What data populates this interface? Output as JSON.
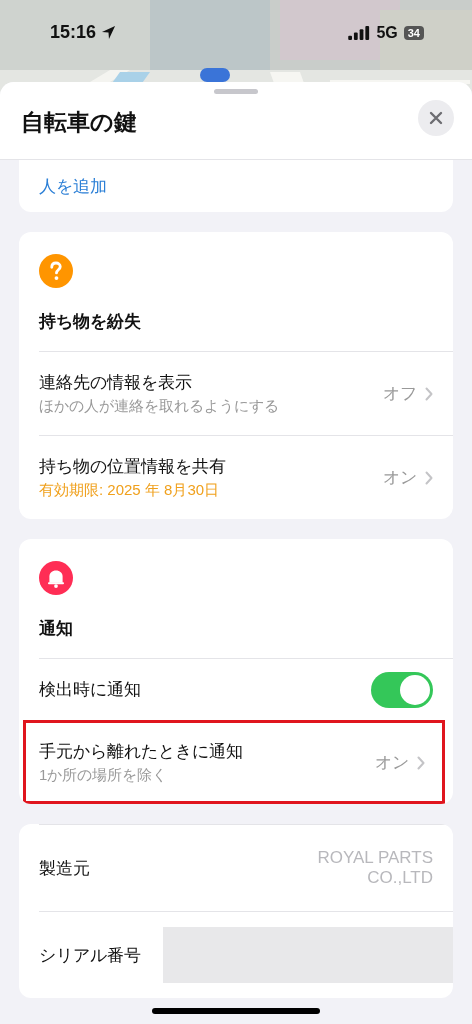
{
  "status_bar": {
    "time": "15:16",
    "network": "5G",
    "battery": "34"
  },
  "sheet": {
    "title": "自転車の鍵"
  },
  "sections": [
    {
      "kind": "plain",
      "clipped": true,
      "rows": [
        {
          "kind": "link",
          "label": "人を追加",
          "highlighted": false
        }
      ]
    },
    {
      "kind": "lost-item",
      "clipped": false,
      "color": "#ff9500",
      "heading": "持ち物を紛失",
      "rows": [
        {
          "kind": "disclosure",
          "label": "連絡先の情報を表示",
          "subtitle": "ほかの人が連絡を取れるようにする",
          "subtitle_warning": false,
          "value": "オフ",
          "highlighted": false
        },
        {
          "kind": "disclosure",
          "label": "持ち物の位置情報を共有",
          "subtitle": "有効期限: 2025 年 8月30日",
          "subtitle_warning": true,
          "value": "オン",
          "highlighted": false
        }
      ]
    },
    {
      "kind": "notification",
      "clipped": false,
      "color": "#ff2d55",
      "heading": "通知",
      "rows": [
        {
          "kind": "toggle",
          "label": "検出時に通知",
          "on": true,
          "highlighted": false
        },
        {
          "kind": "disclosure",
          "label": "手元から離れたときに通知",
          "subtitle": "1か所の場所を除く",
          "subtitle_warning": false,
          "value": "オン",
          "highlighted": true
        }
      ]
    },
    {
      "kind": "plain",
      "clipped": false,
      "rows": [
        {
          "kind": "info",
          "label": "製造元",
          "value": "ROYAL PARTS CO.,LTD",
          "highlighted": false
        },
        {
          "kind": "info",
          "label": "シリアル番号",
          "redacted": true,
          "highlighted": false
        }
      ]
    }
  ]
}
